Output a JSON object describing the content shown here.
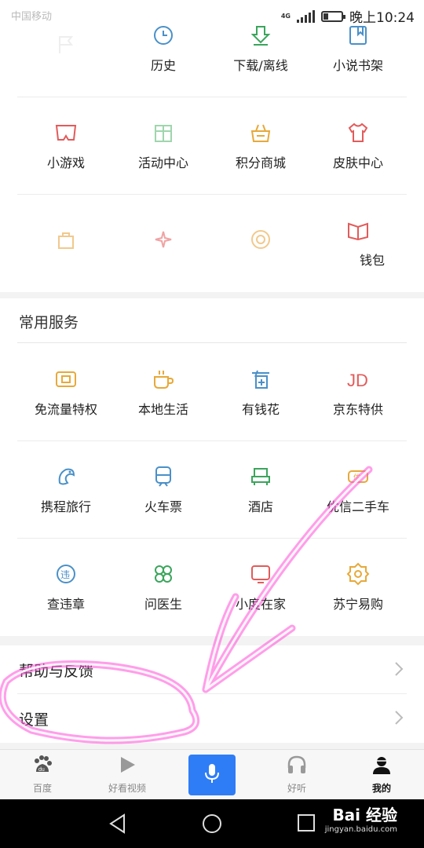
{
  "status": {
    "left_text": "中国移动",
    "network": "4G",
    "time": "晚上10:24"
  },
  "top_grid": {
    "rows": [
      [
        {
          "label": "",
          "icon": "flag-icon",
          "color": "#f0f0f0"
        },
        {
          "label": "历史",
          "icon": "clock-icon",
          "color": "#4a90c8"
        },
        {
          "label": "下载/离线",
          "icon": "download-icon",
          "color": "#3ba55c"
        },
        {
          "label": "小说书架",
          "icon": "bookmark-icon",
          "color": "#4a90c8"
        }
      ],
      [
        {
          "label": "小游戏",
          "icon": "game-icon",
          "color": "#e25b5b"
        },
        {
          "label": "活动中心",
          "icon": "gift-box-icon",
          "color": "#3ba55c"
        },
        {
          "label": "积分商城",
          "icon": "shop-icon",
          "color": "#e7a93a"
        },
        {
          "label": "皮肤中心",
          "icon": "shirt-icon",
          "color": "#e25b5b"
        }
      ],
      [
        {
          "label": "",
          "icon": "bag-icon",
          "color": "#e7a93a"
        },
        {
          "label": "",
          "icon": "sparkle-icon",
          "color": "#e25b5b"
        },
        {
          "label": "",
          "icon": "coin-icon",
          "color": "#e7a93a"
        },
        {
          "label": "钱包",
          "sub": "",
          "icon": "wallet-icon",
          "color": "#e25b5b"
        }
      ]
    ]
  },
  "services": {
    "title": "常用服务",
    "rows": [
      [
        {
          "label": "免流量特权",
          "icon": "sim-card-icon",
          "color": "#e7a93a"
        },
        {
          "label": "本地生活",
          "icon": "coffee-cup-icon",
          "color": "#e7a93a"
        },
        {
          "label": "有钱花",
          "icon": "money-icon",
          "color": "#4a90c8"
        },
        {
          "label": "京东特供",
          "icon": "jd-logo-icon",
          "color": "#e25b5b"
        }
      ],
      [
        {
          "label": "携程旅行",
          "icon": "dolphin-icon",
          "color": "#4a90c8"
        },
        {
          "label": "火车票",
          "icon": "train-icon",
          "color": "#4a90c8"
        },
        {
          "label": "酒店",
          "icon": "hotel-bed-icon",
          "color": "#3ba55c"
        },
        {
          "label": "优信二手车",
          "icon": "car-icon",
          "color": "#e7a93a"
        }
      ],
      [
        {
          "label": "查违章",
          "icon": "violation-icon",
          "color": "#4a90c8"
        },
        {
          "label": "问医生",
          "icon": "clover-icon",
          "color": "#3ba55c"
        },
        {
          "label": "小度在家",
          "icon": "smart-display-icon",
          "color": "#e25b5b"
        },
        {
          "label": "苏宁易购",
          "icon": "suning-logo-icon",
          "color": "#e7a93a"
        }
      ]
    ]
  },
  "list": {
    "help_label": "帮助与反馈",
    "settings_label": "设置"
  },
  "tabs": [
    {
      "label": "百度",
      "icon": "baidu-paw-icon"
    },
    {
      "label": "好看视频",
      "icon": "play-icon"
    },
    {
      "label": "",
      "icon": "microphone-icon"
    },
    {
      "label": "好听",
      "icon": "headphones-icon"
    },
    {
      "label": "我的",
      "icon": "user-icon"
    }
  ],
  "watermark": {
    "brand": "Bai 经验",
    "url": "jingyan.baidu.com"
  },
  "colors": {
    "accent": "#2f7df6",
    "annotation": "#ff4fd8"
  }
}
